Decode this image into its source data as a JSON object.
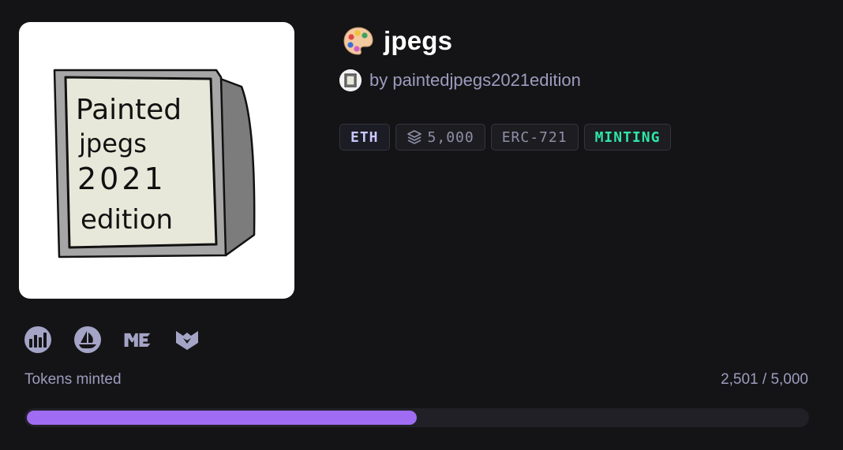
{
  "collection": {
    "title": "jpegs",
    "title_icon": "artist-palette-icon",
    "creator_text": "by paintedjpegs2021edition",
    "artwork_text": [
      "Painted",
      "jpegs",
      "2021",
      "edition"
    ]
  },
  "tags": {
    "chain": "ETH",
    "supply": "5,000",
    "supply_icon": "layers-icon",
    "standard": "ERC-721",
    "status": "MINTING"
  },
  "markets": [
    {
      "name": "chart-market-icon"
    },
    {
      "name": "opensea-icon"
    },
    {
      "name": "magic-eden-icon"
    },
    {
      "name": "fox-market-icon"
    }
  ],
  "progress": {
    "label": "Tokens minted",
    "count_text": "2,501 / 5,000",
    "minted": 2501,
    "total": 5000
  },
  "colors": {
    "background": "#141416",
    "muted_text": "#9d9cbf",
    "progress_fill": "#9f6cf2",
    "status": "#2ee6a6"
  }
}
